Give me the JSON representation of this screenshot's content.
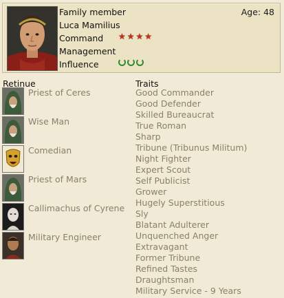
{
  "character": {
    "role": "Family member",
    "name": "Luca Mamilius",
    "age_label": "Age: 48",
    "command_label": "Command",
    "management_label": "Management",
    "influence_label": "Influence",
    "command_stars": 4,
    "influence_laurels": 3,
    "star_color": "#b8341c",
    "laurel_color": "#2d8a2d"
  },
  "retinue": {
    "title": "Retinue",
    "items": [
      {
        "name": "Priest of Ceres",
        "icon": "hooded-priest-icon"
      },
      {
        "name": "Wise Man",
        "icon": "hooded-wise-man-icon"
      },
      {
        "name": "Comedian",
        "icon": "comedy-mask-icon"
      },
      {
        "name": "Priest of Mars",
        "icon": "hooded-priest-icon"
      },
      {
        "name": "Callimachus of Cyrene",
        "icon": "bald-scholar-icon"
      },
      {
        "name": "Military Engineer",
        "icon": "engineer-icon"
      }
    ]
  },
  "traits": {
    "title": "Traits",
    "items": [
      "Good Commander",
      "Good Defender",
      "Skilled Bureaucrat",
      "True Roman",
      "Sharp",
      "Tribune (Tribunus Militum)",
      "Night Fighter",
      "Expert Scout",
      "Self Publicist",
      "Grower",
      "Hugely Superstitious",
      "Sly",
      "Blatant Adulterer",
      "Unquenched Anger",
      "Extravagant",
      "Former Tribune",
      "Refined Tastes",
      "Draughtsman",
      "Military Service - 9 Years"
    ]
  }
}
